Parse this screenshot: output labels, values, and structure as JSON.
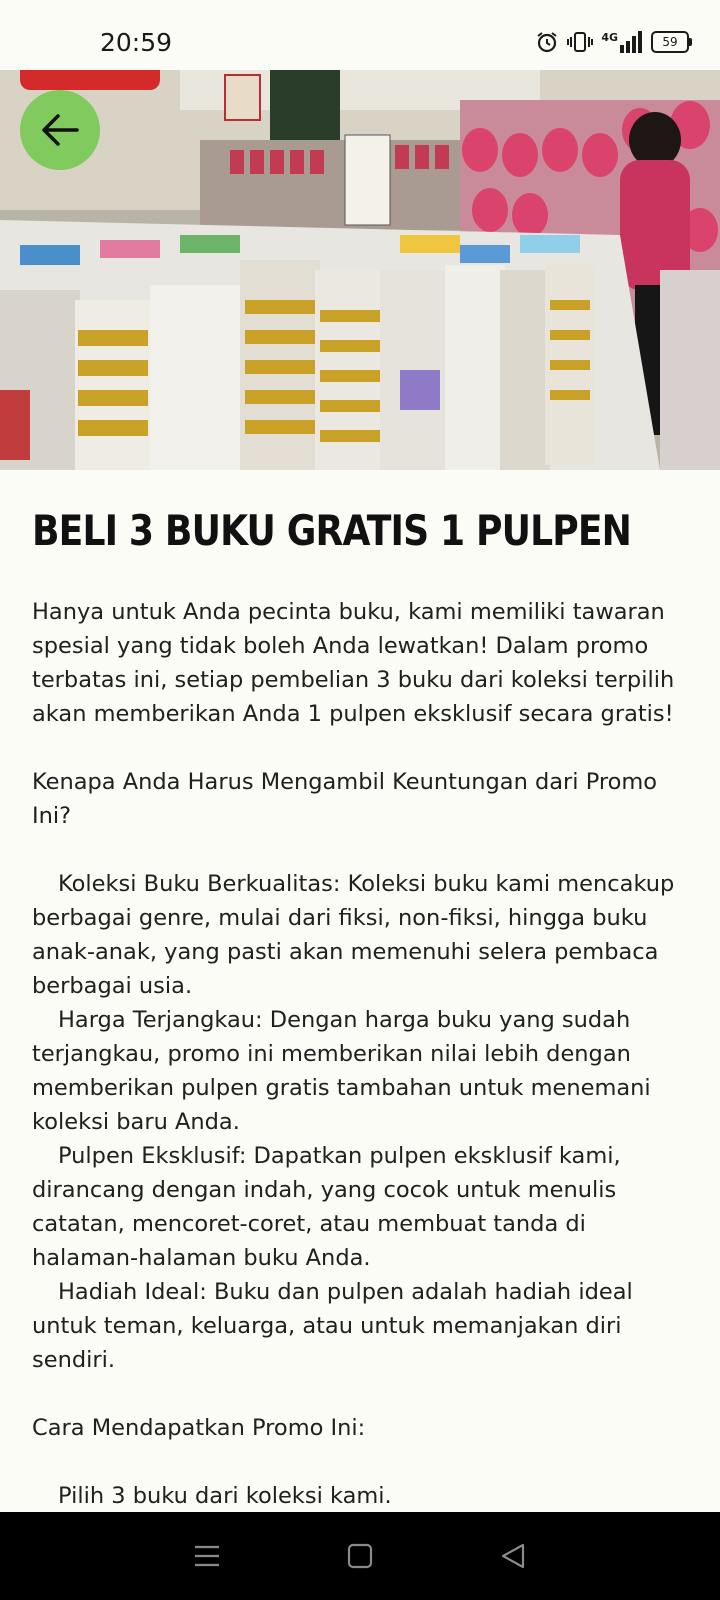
{
  "status_bar": {
    "time": "20:59",
    "network": "4G",
    "battery": "59"
  },
  "hero_image": {
    "description_icon": "bookstore-photo"
  },
  "article": {
    "title": "BELI 3 BUKU GRATIS 1 PULPEN",
    "intro": "Hanya untuk Anda pecinta buku, kami memiliki tawaran spesial yang tidak boleh Anda lewatkan! Dalam promo terbatas ini, setiap pembelian 3 buku dari koleksi terpilih akan memberikan Anda 1 pulpen eksklusif secara gratis!",
    "why_heading": "Kenapa Anda Harus Mengambil Keuntungan dari Promo Ini?",
    "benefits": [
      "Koleksi Buku Berkualitas: Koleksi buku kami mencakup berbagai genre, mulai dari fiksi, non-fiksi, hingga buku anak-anak, yang pasti akan memenuhi selera pembaca berbagai usia.",
      "Harga Terjangkau: Dengan harga buku yang sudah terjangkau, promo ini memberikan nilai lebih dengan memberikan pulpen gratis tambahan untuk menemani koleksi baru Anda.",
      "Pulpen Eksklusif: Dapatkan pulpen eksklusif kami, dirancang dengan indah, yang cocok untuk menulis catatan, mencoret-coret, atau membuat tanda di halaman-halaman buku Anda.",
      "Hadiah Ideal: Buku dan pulpen adalah hadiah ideal untuk teman, keluarga, atau untuk memanjakan diri sendiri."
    ],
    "how_heading": "Cara Mendapatkan Promo Ini:",
    "steps": [
      "Pilih 3 buku dari koleksi kami."
    ]
  },
  "colors": {
    "background": "#fcfcf7",
    "back_button": "#6ec846",
    "nav_bar": "#000000"
  }
}
